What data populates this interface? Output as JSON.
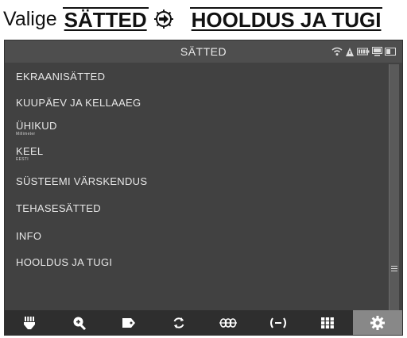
{
  "instruction": {
    "prefix": "Valige",
    "menu": "SÄTTED",
    "target": "HOOLDUS JA TUGI",
    "arrow_icon": "arrow-right-icon"
  },
  "screen": {
    "title": "SÄTTED",
    "status_icons": [
      "wifi-icon",
      "alert-icon",
      "battery-icon",
      "computer-icon",
      "screen-icon"
    ],
    "items": [
      {
        "label": "EKRAANISÄTTED",
        "sub": ""
      },
      {
        "label": "KUUPÄEV JA KELLAAEG",
        "sub": ""
      },
      {
        "label": "ÜHIKUD",
        "sub": "Millimeter"
      },
      {
        "label": "KEEL",
        "sub": "EESTI"
      },
      {
        "label": "SÜSTEEMI VÄRSKENDUS",
        "sub": ""
      },
      {
        "label": "TEHASESÄTTED",
        "sub": ""
      },
      {
        "label": "INFO",
        "sub": ""
      },
      {
        "label": "HOOLDUS JA TUGI",
        "sub": ""
      }
    ],
    "toolbar": [
      {
        "icon": "locator-icon",
        "active": false
      },
      {
        "icon": "zoom-in-icon",
        "active": false
      },
      {
        "icon": "tag-icon",
        "active": false
      },
      {
        "icon": "refresh-icon",
        "active": false
      },
      {
        "icon": "coil-icon",
        "active": false
      },
      {
        "icon": "signal-icon",
        "active": false
      },
      {
        "icon": "grid-icon",
        "active": false
      },
      {
        "icon": "gear-icon",
        "active": true
      }
    ],
    "colors": {
      "screen_bg": "#414141",
      "titlebar_bg": "#4e4e4e",
      "toolbar_bg": "#2e2e2e",
      "active_tool_bg": "#888888",
      "text": "#e8e8e8"
    }
  }
}
